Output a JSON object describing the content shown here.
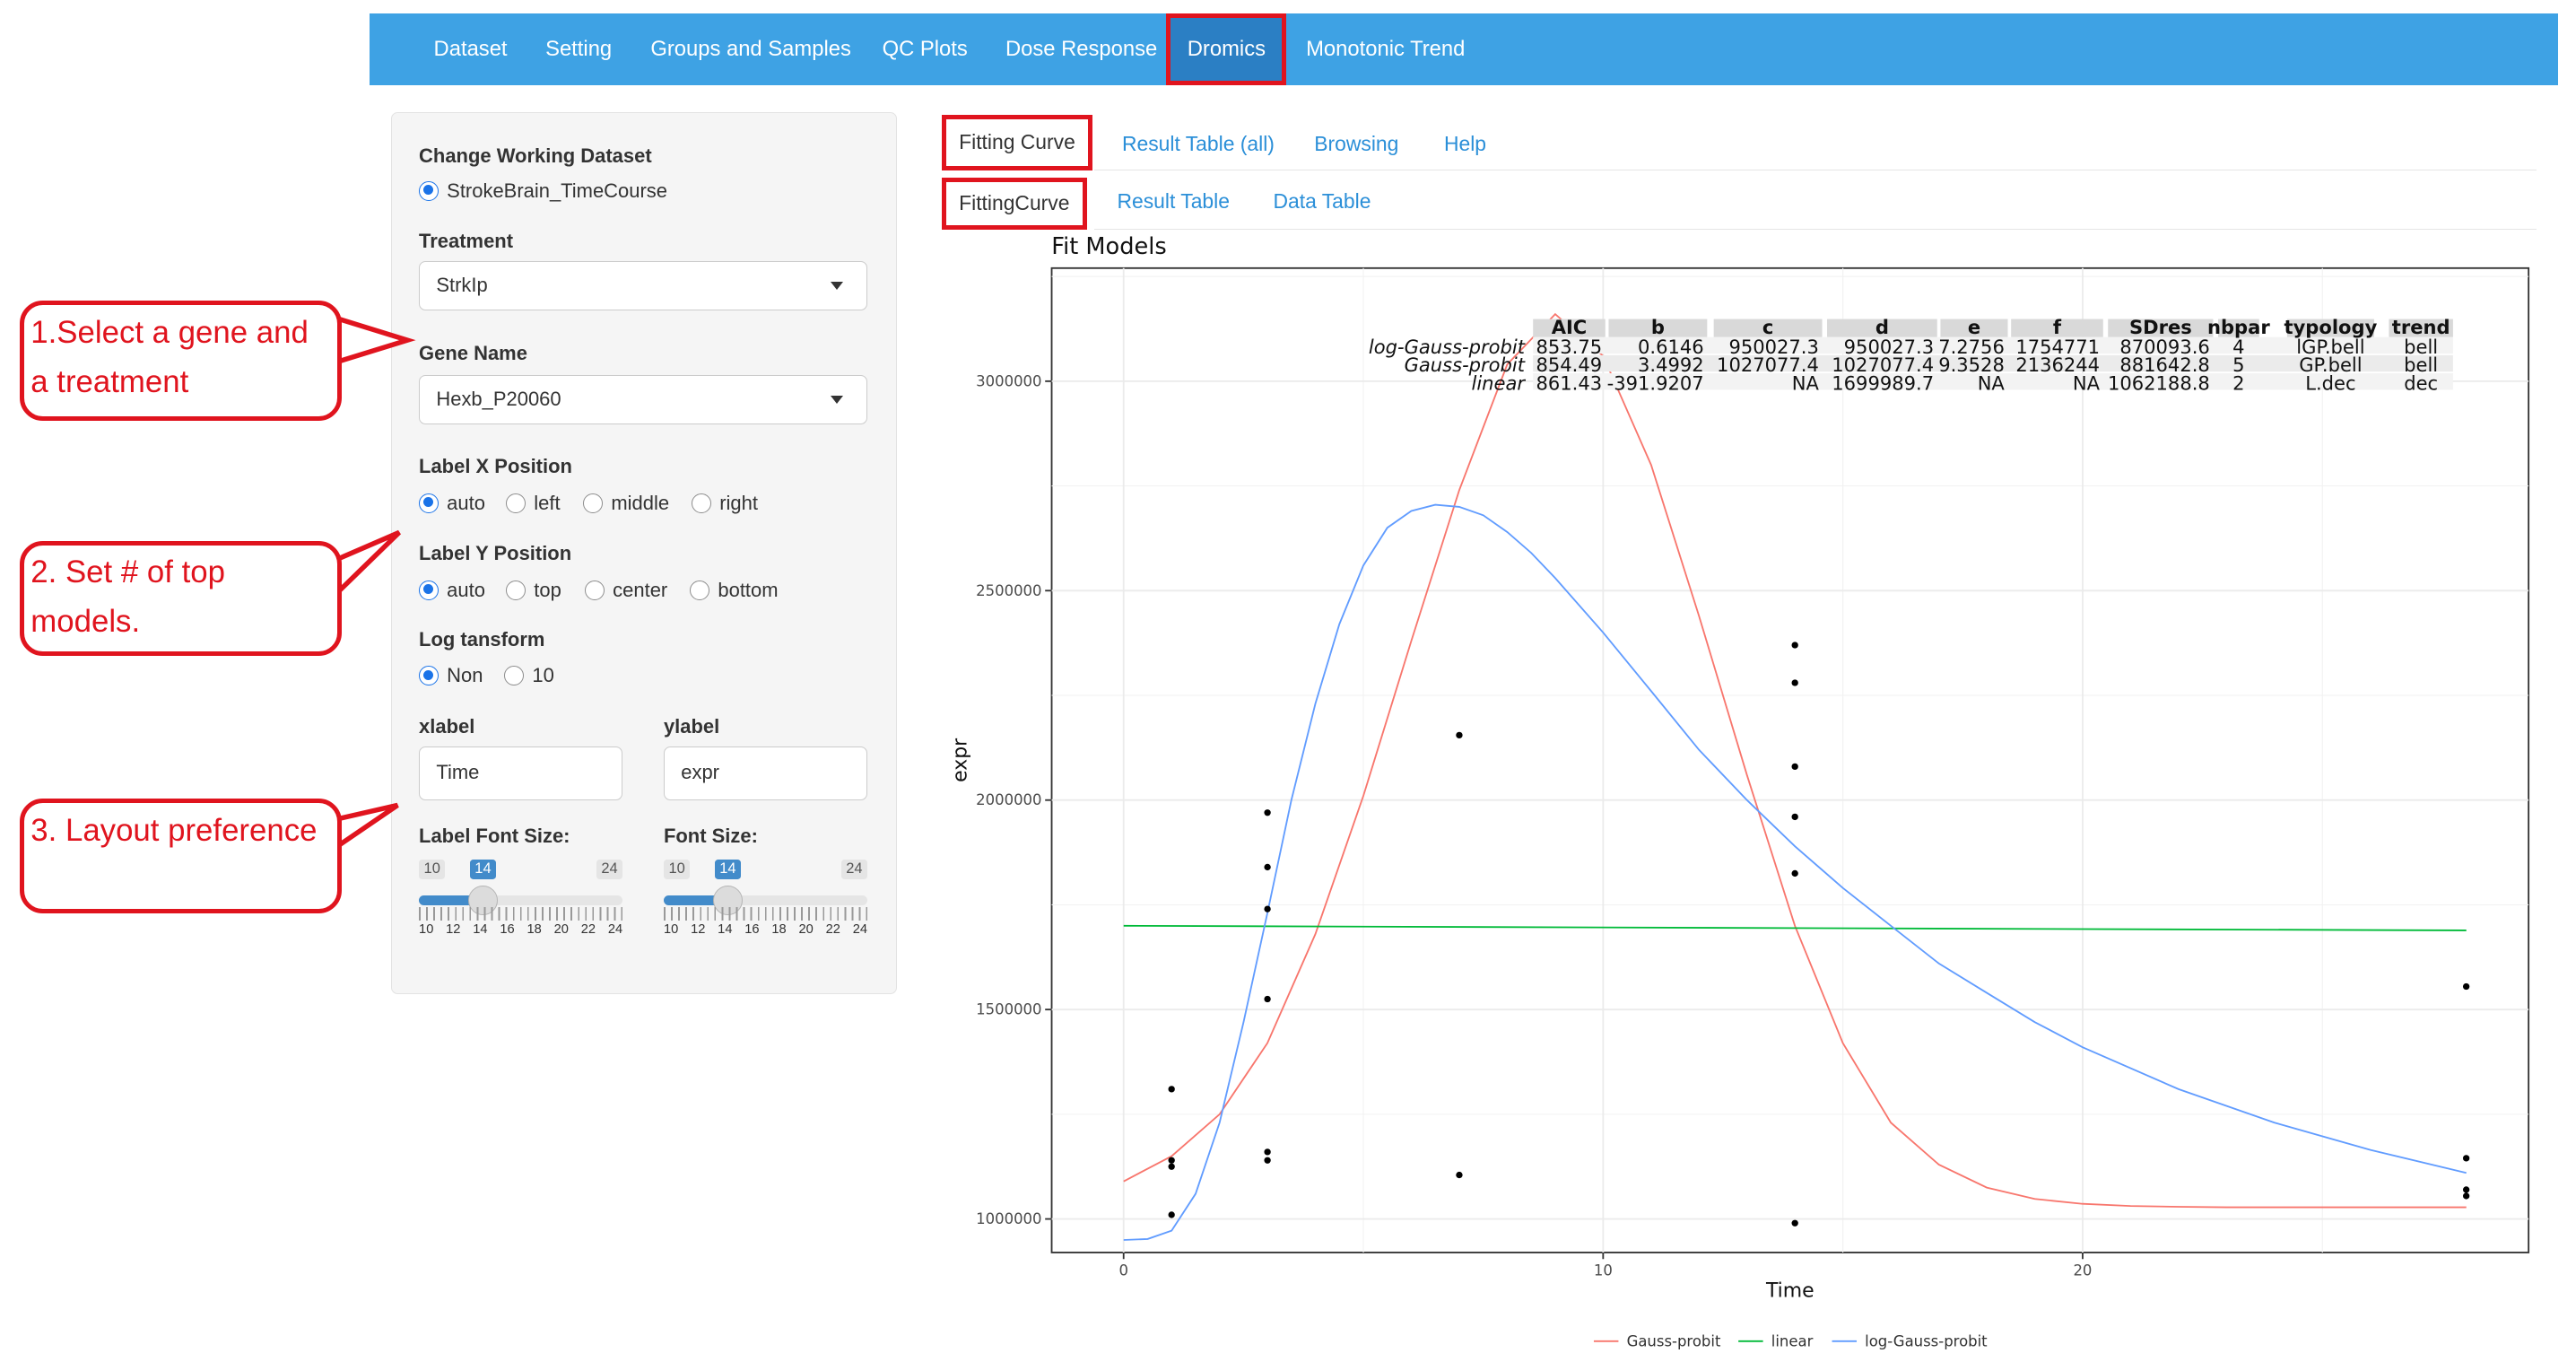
{
  "nav": {
    "items": [
      "Dataset",
      "Setting",
      "Groups and Samples",
      "QC Plots",
      "Dose Response",
      "Dromics",
      "Monotonic Trend"
    ],
    "active": "Dromics"
  },
  "sidebar": {
    "dataset_label": "Change Working Dataset",
    "dataset_option": "StrokeBrain_TimeCourse",
    "treatment_label": "Treatment",
    "treatment_value": "StrkIp",
    "gene_label": "Gene Name",
    "gene_value": "Hexb_P20060",
    "labelx_label": "Label X Position",
    "labelx_options": [
      "auto",
      "left",
      "middle",
      "right"
    ],
    "labelx_selected": "auto",
    "labely_label": "Label Y Position",
    "labely_options": [
      "auto",
      "top",
      "center",
      "bottom"
    ],
    "labely_selected": "auto",
    "log_label": "Log tansform",
    "log_options": [
      "Non",
      "10"
    ],
    "log_selected": "Non",
    "xlabel_label": "xlabel",
    "xlabel_value": "Time",
    "ylabel_label": "ylabel",
    "ylabel_value": "expr",
    "label_font_label": "Label Font Size:",
    "font_label": "Font Size:",
    "label_font_slider": {
      "min": "10",
      "max": "24",
      "value": "14",
      "ticks": [
        "10",
        "12",
        "14",
        "16",
        "18",
        "20",
        "22",
        "24"
      ]
    },
    "font_slider": {
      "min": "10",
      "max": "24",
      "value": "14",
      "ticks": [
        "10",
        "12",
        "14",
        "16",
        "18",
        "20",
        "22",
        "24"
      ]
    }
  },
  "callouts": [
    "1.Select a gene and a treatment",
    "2. Set # of top models.",
    "3. Layout preference"
  ],
  "tabs_top": [
    "Fitting Curve",
    "Result Table (all)",
    "Browsing",
    "Help"
  ],
  "tabs_sub": [
    "FittingCurve",
    "Result Table",
    "Data Table"
  ],
  "chart_data": {
    "type": "line",
    "title": "Fit Models",
    "xlabel": "Time",
    "ylabel": "expr",
    "xlim": [
      -1.5,
      29.3
    ],
    "ylim": [
      920000,
      3270000
    ],
    "xticks": [
      0,
      10,
      20
    ],
    "yticks": [
      1000000,
      1500000,
      2000000,
      2500000,
      3000000
    ],
    "ytick_labels": [
      "1000000",
      "1500000",
      "2000000",
      "2500000",
      "3000000"
    ],
    "grid": true,
    "legend_position": "bottom",
    "series": [
      {
        "name": "Gauss-probit",
        "color": "#f8766d",
        "x": [
          0,
          1,
          2,
          3,
          4,
          5,
          6,
          7,
          8,
          9,
          10,
          11,
          12,
          13,
          14,
          15,
          16,
          17,
          18,
          19,
          20,
          21,
          22,
          23,
          24,
          25,
          26,
          27,
          28
        ],
        "y": [
          1090000,
          1150000,
          1250000,
          1420000,
          1680000,
          2010000,
          2380000,
          2740000,
          3040000,
          3160000,
          3060000,
          2800000,
          2440000,
          2060000,
          1700000,
          1420000,
          1230000,
          1130000,
          1075000,
          1048000,
          1036000,
          1031000,
          1029000,
          1028000,
          1028000,
          1028000,
          1028000,
          1028000,
          1028000
        ]
      },
      {
        "name": "linear",
        "color": "#00ba38",
        "x": [
          0,
          28
        ],
        "y": [
          1700000,
          1689000
        ]
      },
      {
        "name": "log-Gauss-probit",
        "color": "#619cff",
        "x": [
          0,
          0.5,
          1,
          1.5,
          2,
          2.5,
          3,
          3.5,
          4,
          4.5,
          5,
          5.5,
          6,
          6.5,
          7,
          7.5,
          8,
          8.5,
          9,
          10,
          11,
          12,
          13,
          14,
          15,
          16,
          17,
          18,
          19,
          20,
          22,
          24,
          26,
          28
        ],
        "y": [
          950000,
          952000,
          972000,
          1060000,
          1230000,
          1470000,
          1730000,
          2000000,
          2230000,
          2420000,
          2560000,
          2650000,
          2690000,
          2705000,
          2700000,
          2680000,
          2640000,
          2590000,
          2530000,
          2400000,
          2260000,
          2120000,
          2000000,
          1890000,
          1790000,
          1700000,
          1610000,
          1540000,
          1470000,
          1410000,
          1310000,
          1230000,
          1165000,
          1110000
        ]
      }
    ],
    "points": [
      {
        "x": 1,
        "y": 1310000
      },
      {
        "x": 1,
        "y": 1140000
      },
      {
        "x": 1,
        "y": 1125000
      },
      {
        "x": 1,
        "y": 1010000
      },
      {
        "x": 3,
        "y": 1970000
      },
      {
        "x": 3,
        "y": 1840000
      },
      {
        "x": 3,
        "y": 1740000
      },
      {
        "x": 3,
        "y": 1525000
      },
      {
        "x": 3,
        "y": 1160000
      },
      {
        "x": 3,
        "y": 1140000
      },
      {
        "x": 7,
        "y": 2155000
      },
      {
        "x": 7,
        "y": 1105000
      },
      {
        "x": 14,
        "y": 2370000
      },
      {
        "x": 14,
        "y": 2280000
      },
      {
        "x": 14,
        "y": 2080000
      },
      {
        "x": 14,
        "y": 1960000
      },
      {
        "x": 14,
        "y": 1825000
      },
      {
        "x": 14,
        "y": 990000
      },
      {
        "x": 28,
        "y": 1555000
      },
      {
        "x": 28,
        "y": 1145000
      },
      {
        "x": 28,
        "y": 1070000
      },
      {
        "x": 28,
        "y": 1055000
      }
    ],
    "table": {
      "header": [
        "AIC",
        "b",
        "c",
        "d",
        "e",
        "f",
        "SDres",
        "nbpar",
        "typology",
        "trend"
      ],
      "rows": [
        {
          "model": "log-Gauss-probit",
          "cells": [
            "853.75",
            "0.6146",
            "950027.3",
            "950027.3",
            "7.2756",
            "1754771",
            "870093.6",
            "4",
            "lGP.bell",
            "bell"
          ]
        },
        {
          "model": "Gauss-probit",
          "cells": [
            "854.49",
            "3.4992",
            "1027077.4",
            "1027077.4",
            "9.3528",
            "2136244",
            "881642.8",
            "5",
            "GP.bell",
            "bell"
          ]
        },
        {
          "model": "linear",
          "cells": [
            "861.43",
            "-391.9207",
            "NA",
            "1699989.7",
            "NA",
            "NA",
            "1062188.8",
            "2",
            "L.dec",
            "dec"
          ]
        }
      ]
    }
  }
}
